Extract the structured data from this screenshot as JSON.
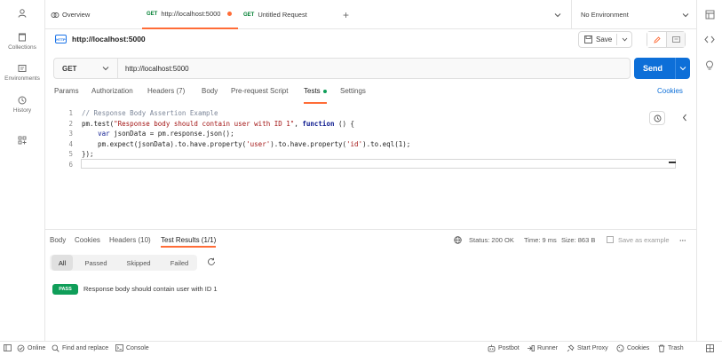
{
  "sidebar": {
    "items": [
      {
        "label": "",
        "icon": "user-icon"
      },
      {
        "label": "Collections",
        "icon": "collections-icon"
      },
      {
        "label": "Environments",
        "icon": "environments-icon"
      },
      {
        "label": "History",
        "icon": "history-icon"
      },
      {
        "label": "",
        "icon": "workspace-add-icon"
      }
    ]
  },
  "tabs": {
    "overview_label": "Overview",
    "tab1_method": "GET",
    "tab1_label": "http://localhost:5000",
    "tab2_method": "GET",
    "tab2_label": "Untitled Request",
    "new_tab_symbol": "+",
    "environment": "No Environment"
  },
  "request": {
    "title": "http://localhost:5000",
    "save_label": "Save",
    "method": "GET",
    "url": "http://localhost:5000",
    "send_label": "Send",
    "cookies_label": "Cookies",
    "subtabs": [
      "Params",
      "Authorization",
      "Headers (7)",
      "Body",
      "Pre-request Script",
      "Tests",
      "Settings"
    ],
    "active_subtab": "Tests"
  },
  "editor": {
    "line_numbers": [
      "1",
      "2",
      "3",
      "4",
      "5",
      "6"
    ],
    "lines": {
      "l1": "// Response Body Assertion Example",
      "l2a": "pm.test(",
      "l2b": "\"Response body should contain user with ID 1\"",
      "l2c": ", ",
      "l2d": "function",
      "l2e": " () {",
      "l3a": "    ",
      "l3b": "var",
      "l3c": " jsonData = pm.response.json();",
      "l4a": "    pm.expect(jsonData).to.have.property(",
      "l4b": "'user'",
      "l4c": ").to.have.property(",
      "l4d": "'id'",
      "l4e": ").to.eql(1);",
      "l5": "});"
    }
  },
  "response": {
    "tabs": [
      "Body",
      "Cookies",
      "Headers (10)",
      "Test Results (1/1)"
    ],
    "active_tab": "Test Results (1/1)",
    "status": "Status: 200 OK",
    "time": "Time: 9 ms",
    "size": "Size: 863 B",
    "save_example": "Save as example",
    "filters": [
      "All",
      "Passed",
      "Skipped",
      "Failed"
    ],
    "active_filter": "All",
    "result_badge": "PASS",
    "result_text": "Response body should contain user with ID 1"
  },
  "footer": {
    "online": "Online",
    "find_replace": "Find and replace",
    "console": "Console",
    "postbot": "Postbot",
    "runner": "Runner",
    "start_proxy": "Start Proxy",
    "cookies": "Cookies",
    "trash": "Trash"
  },
  "colors": {
    "accent_orange": "#ff6c37",
    "send_blue": "#0d6fd8",
    "get_green": "#007f31",
    "pass_green": "#0f9e59"
  }
}
